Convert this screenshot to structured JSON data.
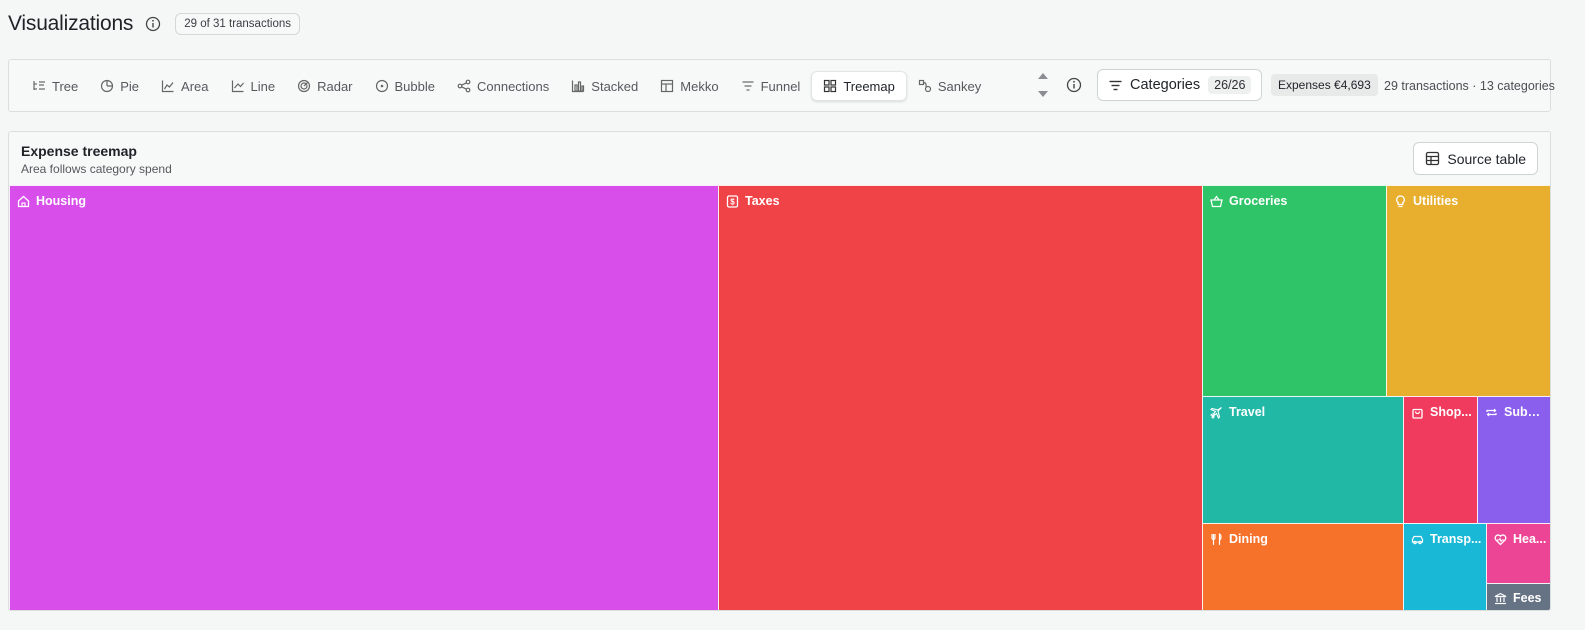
{
  "header": {
    "title": "Visualizations",
    "count_pill": "29 of 31 transactions"
  },
  "tabs": [
    {
      "label": "Tree",
      "icon": "tree-icon"
    },
    {
      "label": "Pie",
      "icon": "pie-icon"
    },
    {
      "label": "Area",
      "icon": "area-icon"
    },
    {
      "label": "Line",
      "icon": "line-icon"
    },
    {
      "label": "Radar",
      "icon": "radar-icon"
    },
    {
      "label": "Bubble",
      "icon": "bubble-icon"
    },
    {
      "label": "Connections",
      "icon": "connections-icon"
    },
    {
      "label": "Stacked",
      "icon": "stacked-icon"
    },
    {
      "label": "Mekko",
      "icon": "mekko-icon"
    },
    {
      "label": "Funnel",
      "icon": "funnel-icon"
    },
    {
      "label": "Treemap",
      "icon": "treemap-icon",
      "active": true
    },
    {
      "label": "Sankey",
      "icon": "sankey-icon"
    }
  ],
  "toolbar": {
    "categories_label": "Categories",
    "categories_count": "26/26",
    "expenses_pill": "Expenses €4,693",
    "summary": "29 transactions · 13 categories"
  },
  "card": {
    "title": "Expense treemap",
    "subtitle": "Area follows category spend",
    "source_button": "Source table"
  },
  "treemap": {
    "cells": [
      {
        "label": "Housing",
        "icon": "home-icon",
        "color": "#d84eea"
      },
      {
        "label": "Taxes",
        "icon": "dollar-icon",
        "color": "#ef4347"
      },
      {
        "label": "Groceries",
        "icon": "basket-icon",
        "color": "#2fc467"
      },
      {
        "label": "Utilities",
        "icon": "lightbulb-icon",
        "color": "#e8ae2e"
      },
      {
        "label": "Travel",
        "icon": "plane-icon",
        "color": "#21b8a6"
      },
      {
        "label": "Shop...",
        "icon": "bag-icon",
        "color": "#f03b5f"
      },
      {
        "label": "Subsc...",
        "icon": "repeat-icon",
        "color": "#8a5fee"
      },
      {
        "label": "Dining",
        "icon": "utensils-icon",
        "color": "#f6712a"
      },
      {
        "label": "Transp...",
        "icon": "car-icon",
        "color": "#18b8d6"
      },
      {
        "label": "Hea...",
        "icon": "heart-icon",
        "color": "#ec4596"
      },
      {
        "label": "Fees",
        "icon": "bank-icon",
        "color": "#667384"
      }
    ]
  }
}
